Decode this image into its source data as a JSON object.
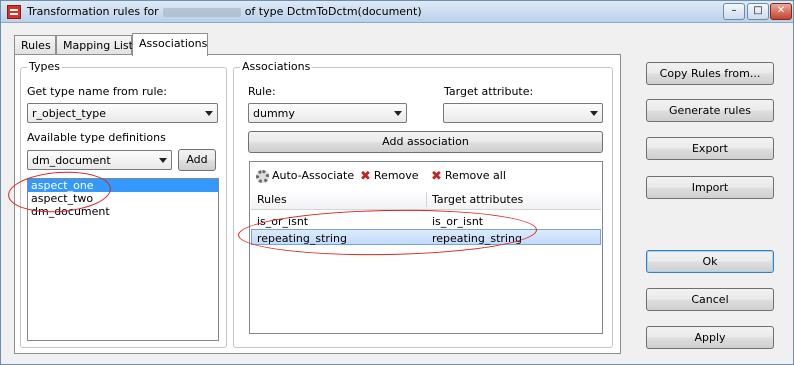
{
  "window": {
    "title_prefix": "Transformation rules for",
    "title_suffix": "of type DctmToDctm(document)",
    "minimize_glyph": "–",
    "maximize_glyph": "□",
    "close_glyph": "✕"
  },
  "tabs": [
    {
      "label": "Rules"
    },
    {
      "label": "Mapping Lists"
    },
    {
      "label": "Associations",
      "active": true
    }
  ],
  "types_group": {
    "title": "Types",
    "get_type_label": "Get type name from rule:",
    "get_type_value": "r_object_type",
    "available_label": "Available type definitions",
    "available_value": "dm_document",
    "add_button": "Add",
    "type_list": [
      "aspect_one",
      "aspect_two",
      "dm_document"
    ],
    "selected_index": 0
  },
  "assoc_group": {
    "title": "Associations",
    "rule_label": "Rule:",
    "rule_value": "dummy",
    "target_label": "Target attribute:",
    "target_value": "",
    "add_association_button": "Add association",
    "toolbar": {
      "auto_associate": "Auto-Associate",
      "remove": "Remove",
      "remove_all": "Remove all"
    },
    "columns": [
      "Rules",
      "Target attributes"
    ],
    "rows": [
      {
        "rule": "is_or_isnt",
        "target": "is_or_isnt"
      },
      {
        "rule": "repeating_string",
        "target": "repeating_string"
      }
    ],
    "selected_row": 1
  },
  "side_buttons": {
    "copy_rules": "Copy Rules from...",
    "generate": "Generate rules",
    "export": "Export",
    "import": "Import",
    "ok": "Ok",
    "cancel": "Cancel",
    "apply": "Apply"
  },
  "colors": {
    "selection": "#3399ff",
    "annotation": "#d9261c",
    "title_gradient_top": "#dfeaf6"
  }
}
